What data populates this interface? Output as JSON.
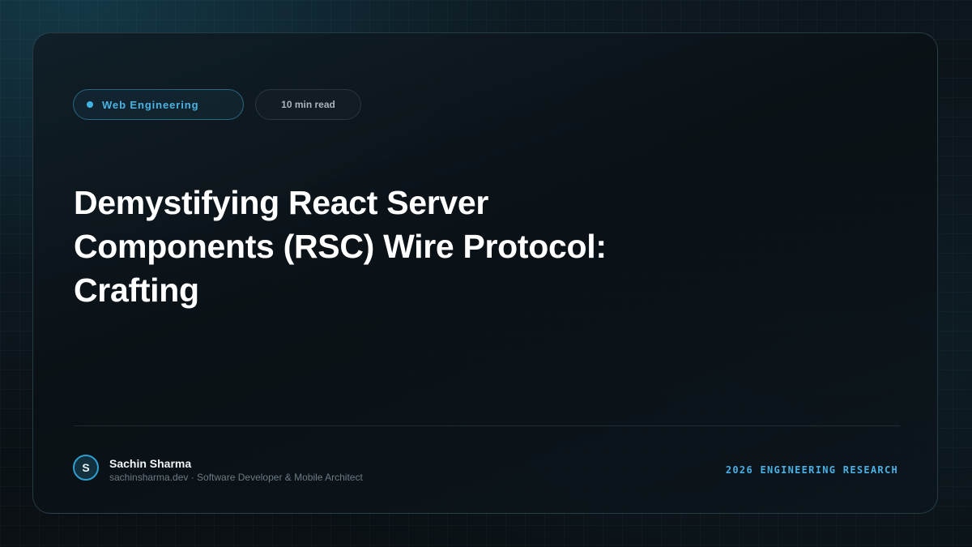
{
  "card": {
    "category": {
      "label": "Web Engineering",
      "accent": "#3fb4e6"
    },
    "read_time": "10 min read",
    "title": "Demystifying React Server Components (RSC) Wire Protocol: Crafting",
    "author": {
      "initial": "S",
      "name": "Sachin Sharma",
      "meta": "sachinsharma.dev · Software Developer & Mobile Architect"
    },
    "footer_tag": "2026 ENGINEERING RESEARCH"
  },
  "colors": {
    "background": "#0a0f13",
    "accent": "#4ab3e4",
    "title": "#ffffff",
    "muted": "#6b7a83"
  }
}
